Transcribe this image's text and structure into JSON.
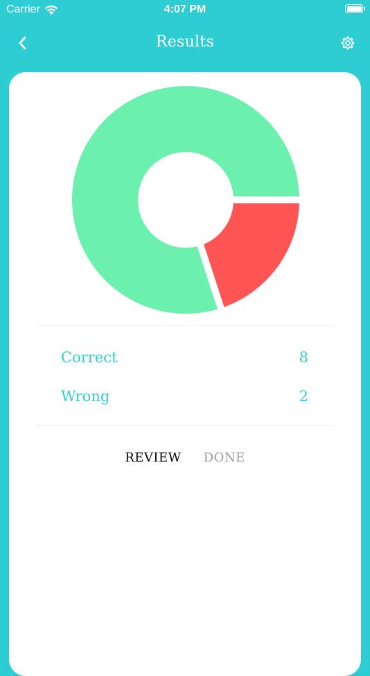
{
  "status_bar": {
    "carrier": "Carrier",
    "time": "4:07 PM"
  },
  "nav": {
    "title": "Results",
    "back_icon": "chevron-left-icon",
    "settings_icon": "gear-icon"
  },
  "chart_data": {
    "type": "pie",
    "categories": [
      "Correct",
      "Wrong"
    ],
    "values": [
      8,
      2
    ],
    "colors": [
      "#6BF0AE",
      "#FF5454"
    ]
  },
  "stats": [
    {
      "label": "Correct",
      "value": "8"
    },
    {
      "label": "Wrong",
      "value": "2"
    }
  ],
  "actions": {
    "review_label": "REVIEW",
    "done_label": "DONE"
  },
  "colors": {
    "accent": "#2ECDD4",
    "card": "#ffffff",
    "correct": "#6BF0AE",
    "wrong": "#FF5454"
  }
}
